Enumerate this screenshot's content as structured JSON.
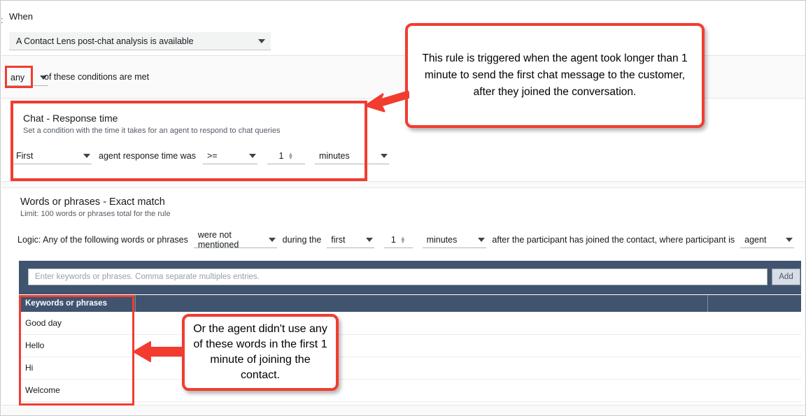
{
  "colors": {
    "annotation_red": "#f23c30",
    "table_header_blue": "#40536f",
    "strip_gray": "#fafafa"
  },
  "when": {
    "label": "When",
    "trigger_value": "A Contact Lens post-chat analysis is available",
    "caret_icon": "chevron-down-icon"
  },
  "conditions": {
    "prefix": ":",
    "match_value": "any",
    "text": "of these conditions are met"
  },
  "chat_response_time": {
    "title": "Chat - Response time",
    "subtitle": "Set a condition with the time it takes for an agent to respond to chat queries",
    "occurrence_value": "First",
    "middle_label": "agent response time was",
    "operator_value": ">=",
    "amount_value": "1",
    "unit_value": "minutes"
  },
  "words_or_phrases": {
    "title": "Words or phrases - Exact match",
    "subtitle": "Limit: 100 words or phrases total for the rule",
    "logic_label": "Logic: Any of the following words or phrases",
    "mention_value": "were not mentioned",
    "during_label": "during the",
    "ordinal_value": "first",
    "amount_value": "1",
    "unit_value": "minutes",
    "after_label": "after the participant has joined the contact, where participant is",
    "participant_value": "agent",
    "input_placeholder": "Enter keywords or phrases. Comma separate multiples entries.",
    "add_button": "Add",
    "table": {
      "columns": [
        "Keywords or phrases",
        "",
        ""
      ],
      "rows": [
        [
          "Good day",
          "",
          ""
        ],
        [
          "Hello",
          "",
          ""
        ],
        [
          "Hi",
          "",
          ""
        ],
        [
          "Welcome",
          "",
          ""
        ]
      ]
    }
  },
  "annotations": {
    "callout_rule": "This rule is triggered when the agent took longer than 1 minute to send the first chat message to the customer, after they joined the conversation.",
    "callout_words": "Or the agent didn't use any of these words in the first 1 minute of joining the contact."
  }
}
